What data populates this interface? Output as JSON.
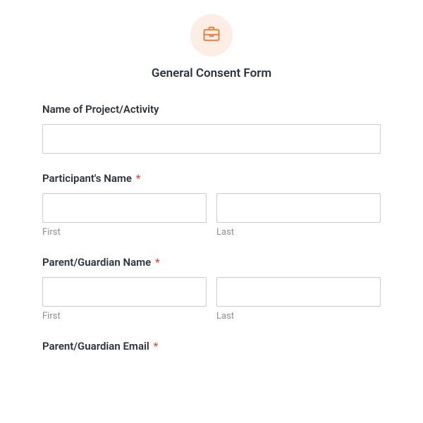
{
  "header": {
    "icon": "briefcase-icon",
    "title": "General Consent Form"
  },
  "colors": {
    "accent": "#e97a3a",
    "icon_bg": "#fdeee5",
    "required": "#e24c3f",
    "border": "#c9ccd0",
    "sublabel": "#8a8f94"
  },
  "fields": {
    "project": {
      "label": "Name of Project/Activity",
      "required": false,
      "value": ""
    },
    "participant": {
      "label": "Participant's Name",
      "required": true,
      "first": {
        "value": "",
        "sublabel": "First"
      },
      "last": {
        "value": "",
        "sublabel": "Last"
      }
    },
    "guardian": {
      "label": "Parent/Guardian Name",
      "required": true,
      "first": {
        "value": "",
        "sublabel": "First"
      },
      "last": {
        "value": "",
        "sublabel": "Last"
      }
    },
    "guardian_email": {
      "label": "Parent/Guardian Email",
      "required": true,
      "value": ""
    }
  },
  "required_marker": "*"
}
